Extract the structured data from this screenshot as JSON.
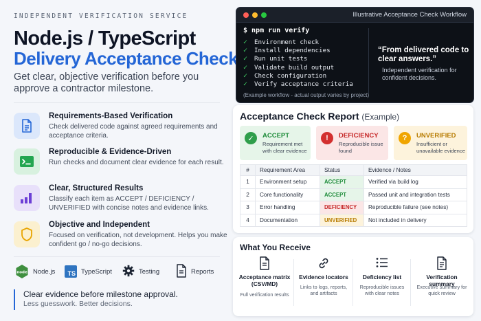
{
  "header": {
    "eyebrow": "INDEPENDENT VERIFICATION SERVICE",
    "title_line1": "Node.js / TypeScript",
    "title_line2": "Delivery Acceptance Check",
    "subtitle": "Get clear, objective verification before you approve a contractor milestone."
  },
  "features": [
    {
      "title": "Requirements-Based Verification",
      "desc": "Check delivered code against agreed requirements and acceptance criteria.",
      "icon": "document-icon"
    },
    {
      "title": "Reproducible & Evidence-Driven",
      "desc": "Run checks and document clear evidence for each result.",
      "icon": "terminal-icon"
    },
    {
      "title": "Clear, Structured Results",
      "desc": "Classify each item as ACCEPT / DEFICIENCY / UNVERIFIED with concise notes and evidence links.",
      "icon": "bar-chart-icon"
    },
    {
      "title": "Objective and Independent",
      "desc": "Focused on verification, not development. Helps you make confident go / no-go decisions.",
      "icon": "shield-icon"
    }
  ],
  "tech": [
    "Node.js",
    "TypeScript",
    "Testing",
    "Reports"
  ],
  "closing": {
    "line1": "Clear evidence before milestone approval.",
    "line2": "Less guesswork. Better decisions."
  },
  "terminal": {
    "title": "Illustrative Acceptance Check Workflow",
    "command": "$ npm run verify",
    "checks": [
      "Environment check",
      "Install dependencies",
      "Run unit tests",
      "Validate build output",
      "Check configuration",
      "Verify acceptance criteria"
    ],
    "note": "(Example workflow - actual output varies by project)",
    "quote": "“From delivered code to clear answers.”",
    "quote_sub": "Independent verification for confident decisions."
  },
  "report": {
    "title": "Acceptance Check Report",
    "title_suffix": "(Example)",
    "statuses": [
      {
        "label": "ACCEPT",
        "desc": "Requirement met with clear evidence",
        "color": "#2e9e4a"
      },
      {
        "label": "DEFICIENCY",
        "desc": "Reproducible issue found",
        "color": "#d32f2f"
      },
      {
        "label": "UNVERIFIED",
        "desc": "Insufficient or unavailable evidence",
        "color": "#f0a500"
      }
    ],
    "columns": [
      "#",
      "Requirement Area",
      "Status",
      "Evidence / Notes"
    ],
    "rows": [
      {
        "n": "1",
        "area": "Environment setup",
        "status": "ACCEPT",
        "notes": "Verified via build log"
      },
      {
        "n": "2",
        "area": "Core functionality",
        "status": "ACCEPT",
        "notes": "Passed unit and integration tests"
      },
      {
        "n": "3",
        "area": "Error handling",
        "status": "DEFICIENCY",
        "notes": "Reproducible failure (see notes)"
      },
      {
        "n": "4",
        "area": "Documentation",
        "status": "UNVERIFIED",
        "notes": "Not included in delivery"
      }
    ]
  },
  "receive": {
    "title": "What You Receive",
    "items": [
      {
        "label": "Acceptance matrix (CSV/MD)",
        "desc": "Full verification results",
        "icon": "file-icon"
      },
      {
        "label": "Evidence locators",
        "desc": "Links to logs, reports, and artifacts",
        "icon": "link-icon"
      },
      {
        "label": "Deficiency list",
        "desc": "Reproducible issues with clear notes",
        "icon": "list-icon"
      },
      {
        "label": "Verification summary",
        "desc": "Executive summary for quick review",
        "icon": "summary-icon"
      }
    ]
  },
  "colors": {
    "accent_blue": "#2466d6",
    "accept": "#1e8c3a",
    "deficiency": "#c62828",
    "unverified": "#b77b00",
    "terminal_bg": "#0d1117"
  }
}
